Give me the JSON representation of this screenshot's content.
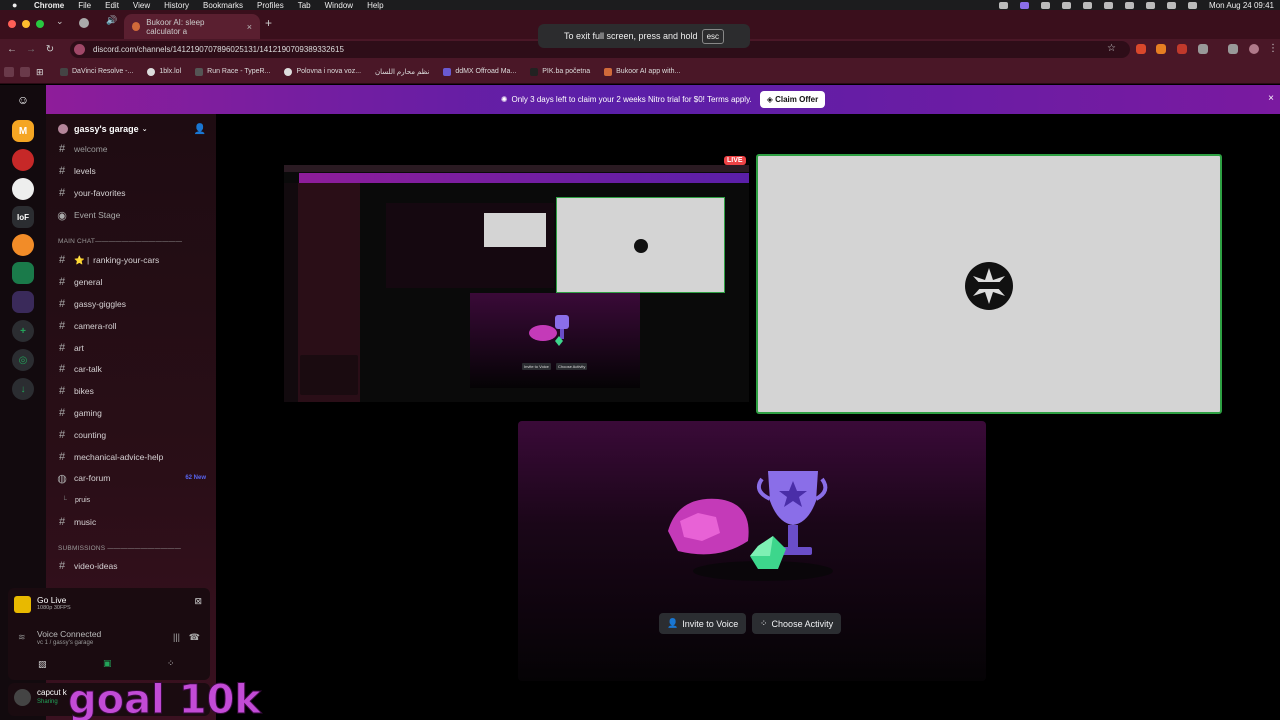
{
  "menubar": {
    "app": "Chrome",
    "items": [
      "File",
      "Edit",
      "View",
      "History",
      "Bookmarks",
      "Profiles",
      "Tab",
      "Window",
      "Help"
    ],
    "clock": "Mon Aug 24  09:41"
  },
  "browser": {
    "tab_title": "Bukoor AI: sleep calculator a",
    "fullscreen_toast": "To exit full screen, press and hold",
    "fullscreen_key": "esc",
    "url": "discord.com/channels/1412190707896025131/1412190709389332615"
  },
  "bookmarks": [
    "DaVinci Resolve -...",
    "1blx.lol",
    "Run Race - TypeR...",
    "Polovna i nova voz...",
    "نظم محارم اللسان",
    "ddMX Offroad Ma...",
    "PIK.ba početna",
    "Bukoor AI app with..."
  ],
  "nitro_banner": {
    "text": "Only 3 days left to claim your 2 weeks Nitro trial for $0! Terms apply.",
    "button": "Claim Offer"
  },
  "server": {
    "name": "gassy's garage"
  },
  "channels_top": [
    {
      "name": "welcome",
      "icon": "hash-icon"
    },
    {
      "name": "levels",
      "icon": "hash-icon"
    },
    {
      "name": "your-favorites",
      "icon": "hash-icon"
    },
    {
      "name": "Event Stage",
      "icon": "stage-icon"
    }
  ],
  "category_main": "MAIN CHAT—————————————",
  "channels_main": [
    {
      "name": "ranking-your-cars",
      "prefix": "⭐ |"
    },
    {
      "name": "general"
    },
    {
      "name": "gassy-giggles"
    },
    {
      "name": "camera-roll"
    },
    {
      "name": "art"
    },
    {
      "name": "car-talk"
    },
    {
      "name": "bikes"
    },
    {
      "name": "gaming"
    },
    {
      "name": "counting"
    },
    {
      "name": "mechanical-advice-help"
    },
    {
      "name": "car-forum",
      "badge": "62 New"
    },
    {
      "name": "pruis",
      "thread": true
    },
    {
      "name": "music"
    }
  ],
  "category_submissions": "SUBMISSIONS ———————————",
  "channels_submissions": [
    {
      "name": "video-ideas"
    }
  ],
  "voice": {
    "go_live": "Go Live",
    "go_live_sub": "1080p 30FPS",
    "connected": "Voice Connected",
    "connected_sub": "vc 1 / gassy's garage"
  },
  "user": {
    "name": "capcut k",
    "status": "Sharing"
  },
  "overlay_text": "goal 10k",
  "stage": {
    "live_badge": "LIVE",
    "invite_button": "Invite to Voice",
    "activity_button": "Choose Activity"
  },
  "colors": {
    "nitro_gradient_start": "#8e1d9a",
    "live_border": "#2ea043",
    "live_badge": "#ed4245",
    "brand": "#5865f2"
  }
}
